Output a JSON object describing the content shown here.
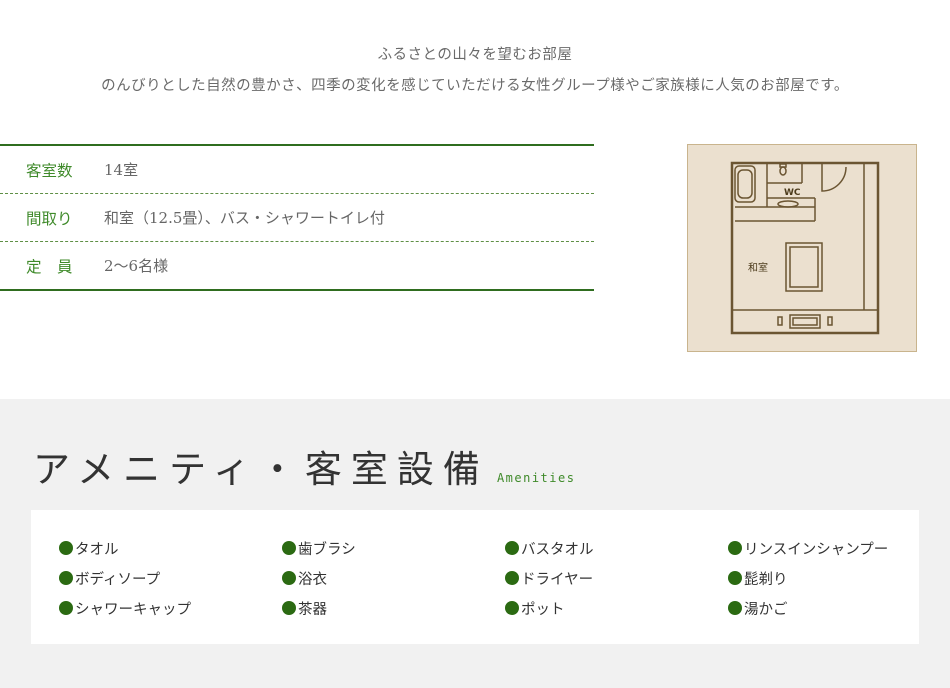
{
  "intro": {
    "title": "ふるさとの山々を望むお部屋",
    "description": "のんびりとした自然の豊かさ、四季の変化を感じていただける女性グループ様やご家族様に人気のお部屋です。"
  },
  "room_specs": [
    {
      "label": "客室数",
      "value": "14室"
    },
    {
      "label": "間取り",
      "value": "和室（12.5畳）、バス・シャワートイレ付"
    },
    {
      "label": "定　員",
      "value": "2〜6名様"
    }
  ],
  "floorplan": {
    "wc_label": "WC",
    "room_label": "和室"
  },
  "amenities": {
    "title": "アメニティ・客室設備",
    "subtitle": "Amenities",
    "bullet_color": "#2b6a12",
    "items": [
      "タオル",
      "歯ブラシ",
      "バスタオル",
      "リンスインシャンプー",
      "ボディソープ",
      "浴衣",
      "ドライヤー",
      "髭剃り",
      "シャワーキャップ",
      "茶器",
      "ポット",
      "湯かご"
    ]
  }
}
